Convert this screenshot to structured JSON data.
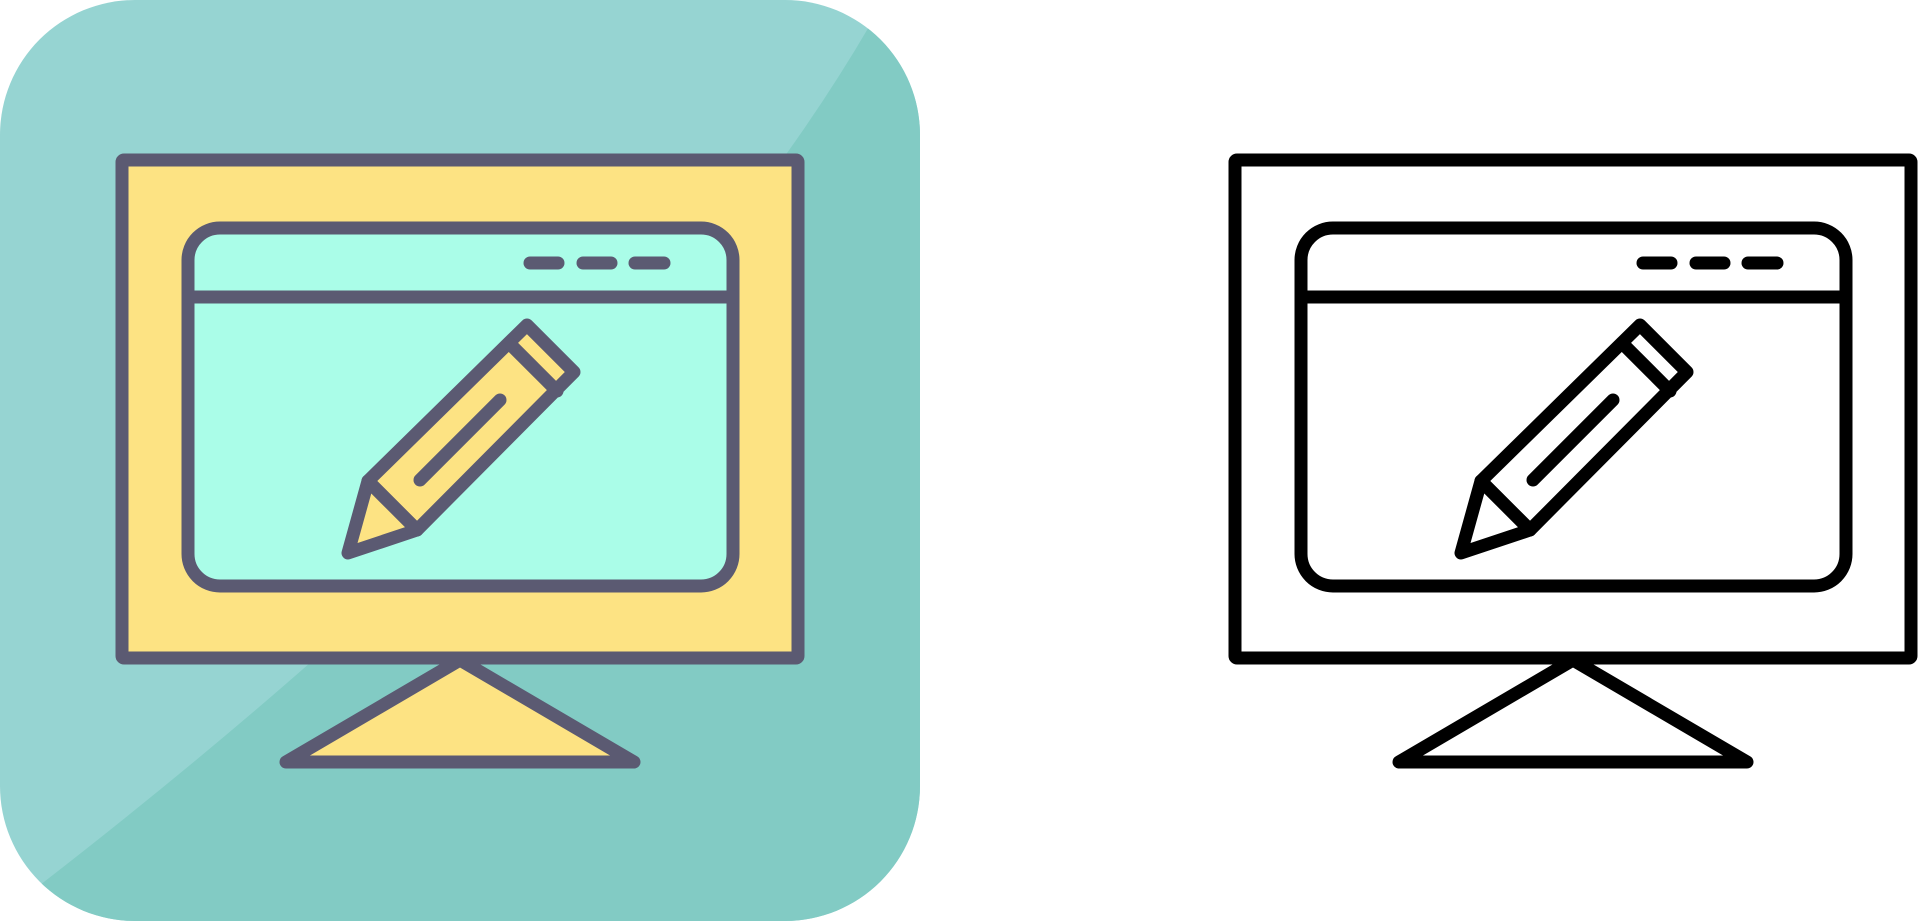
{
  "icons": [
    {
      "name": "monitor-pencil-icon-color",
      "style": "filled",
      "colors": {
        "background_light": "#96D4D2",
        "background_dark": "#82CBC4",
        "screen": "#FDE383",
        "window": "#AAFDE8",
        "stroke": "#5B5A72"
      }
    },
    {
      "name": "monitor-pencil-icon-outline",
      "style": "outline",
      "colors": {
        "background": "#FFFFFF",
        "stroke": "#000000"
      }
    }
  ]
}
